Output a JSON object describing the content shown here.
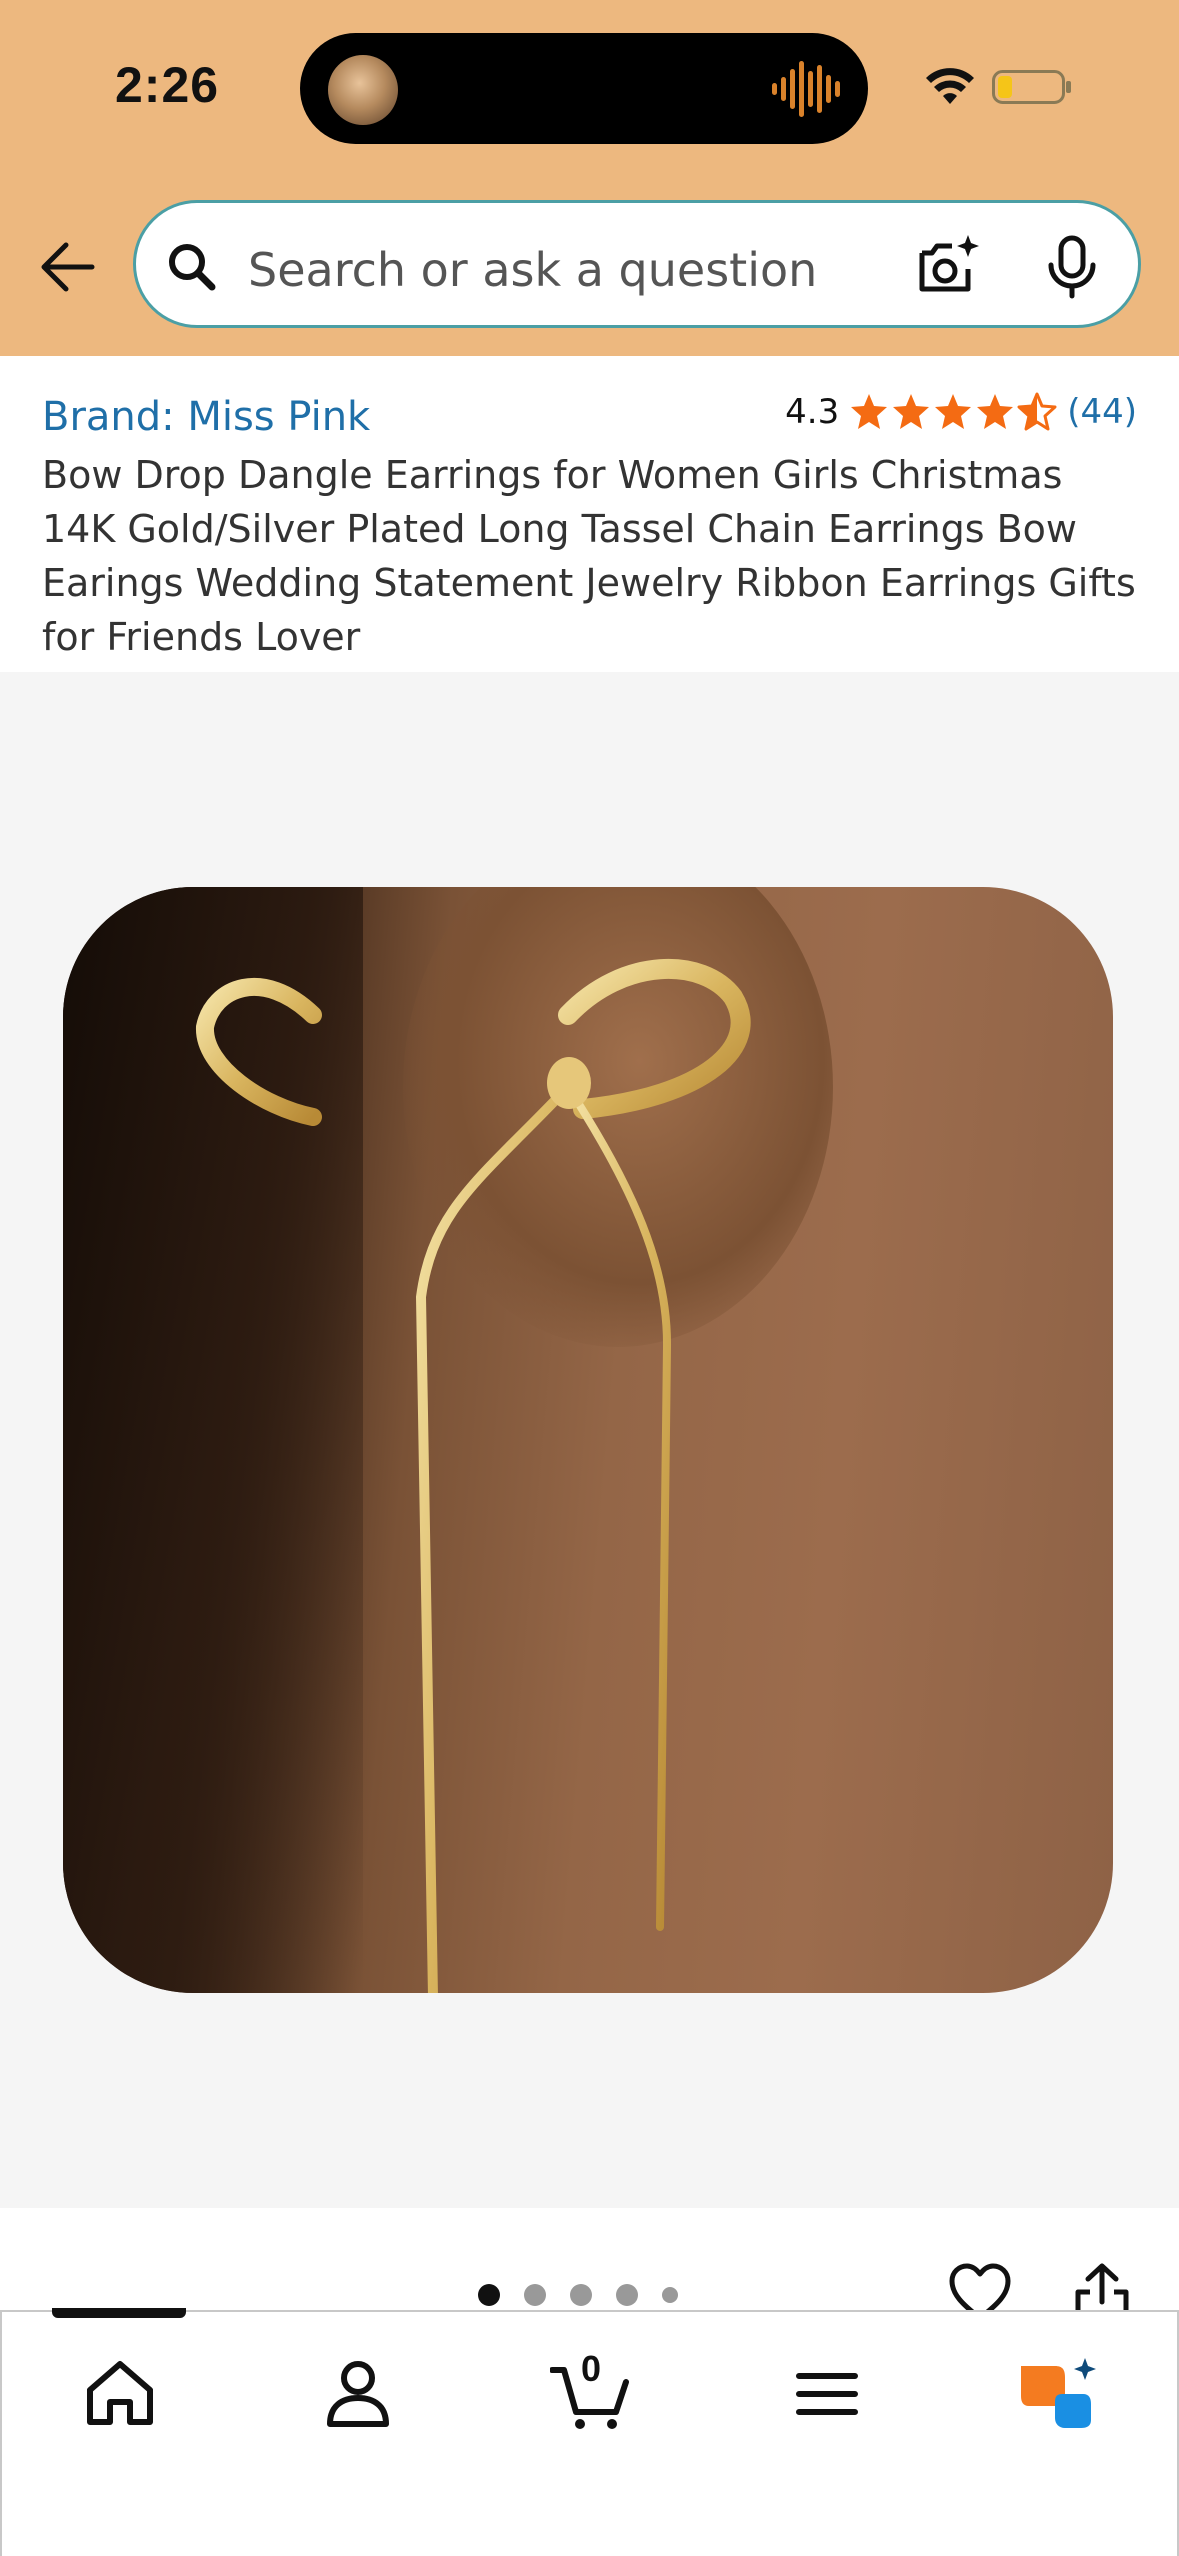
{
  "status_bar": {
    "time": "2:26"
  },
  "search": {
    "placeholder": "Search or ask a question"
  },
  "product": {
    "brand": "Brand: Miss Pink",
    "rating": "4.3",
    "rating_count": "(44)",
    "stars_filled": 4.3,
    "title": "Bow Drop Dangle Earrings for Women Girls Christmas 14K Gold/Silver Plated Long Tassel Chain Earrings Bow Earings Wedding Statement Jewelry Ribbon Earrings Gifts for Friends Lover"
  },
  "carousel": {
    "total_dots": 5,
    "active_index": 0
  },
  "bottom_nav": {
    "items": [
      "home-icon",
      "profile-icon",
      "cart-icon",
      "menu-icon",
      "rufus-ai-icon"
    ],
    "cart_count": "0"
  },
  "colors": {
    "header_bg": "#EDB87F",
    "link_blue": "#1f6fa8",
    "star_orange": "#F46B13",
    "rufus_orange": "#F47B20",
    "rufus_blue": "#1a8fe3"
  }
}
